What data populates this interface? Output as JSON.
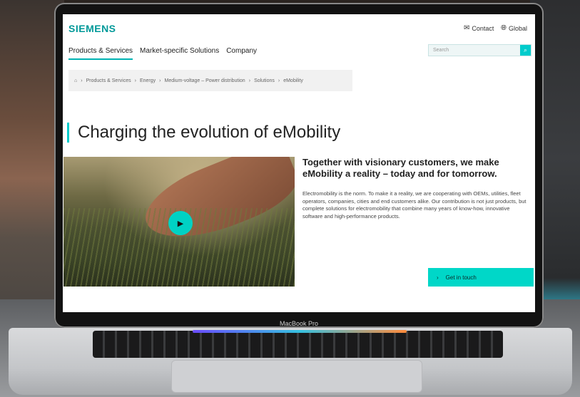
{
  "device_label": "MacBook Pro",
  "site": {
    "logo": "SIEMENS",
    "utility": {
      "contact": "Contact",
      "global": "Global"
    },
    "nav": [
      "Products & Services",
      "Market-specific Solutions",
      "Company"
    ],
    "search_placeholder": "Search",
    "breadcrumb": [
      "Products & Services",
      "Energy",
      "Medium-voltage – Power distribution",
      "Solutions",
      "eMobility"
    ],
    "headline": "Charging the evolution of eMobility",
    "subheadline": "Together with visionary customers, we make eMobility a reality – today and for tomorrow.",
    "body": "Electromobility is the norm. To make it a reality, we are cooperating with OEMs, utilities, fleet operators, companies, cities and end customers alike. Our contribution is not just products, but complete solutions for electromobility that combine many years of know-how, innovative software and high-performance products.",
    "cta": "Get in touch"
  },
  "colors": {
    "brand": "#009999",
    "accent": "#00d7c8"
  }
}
